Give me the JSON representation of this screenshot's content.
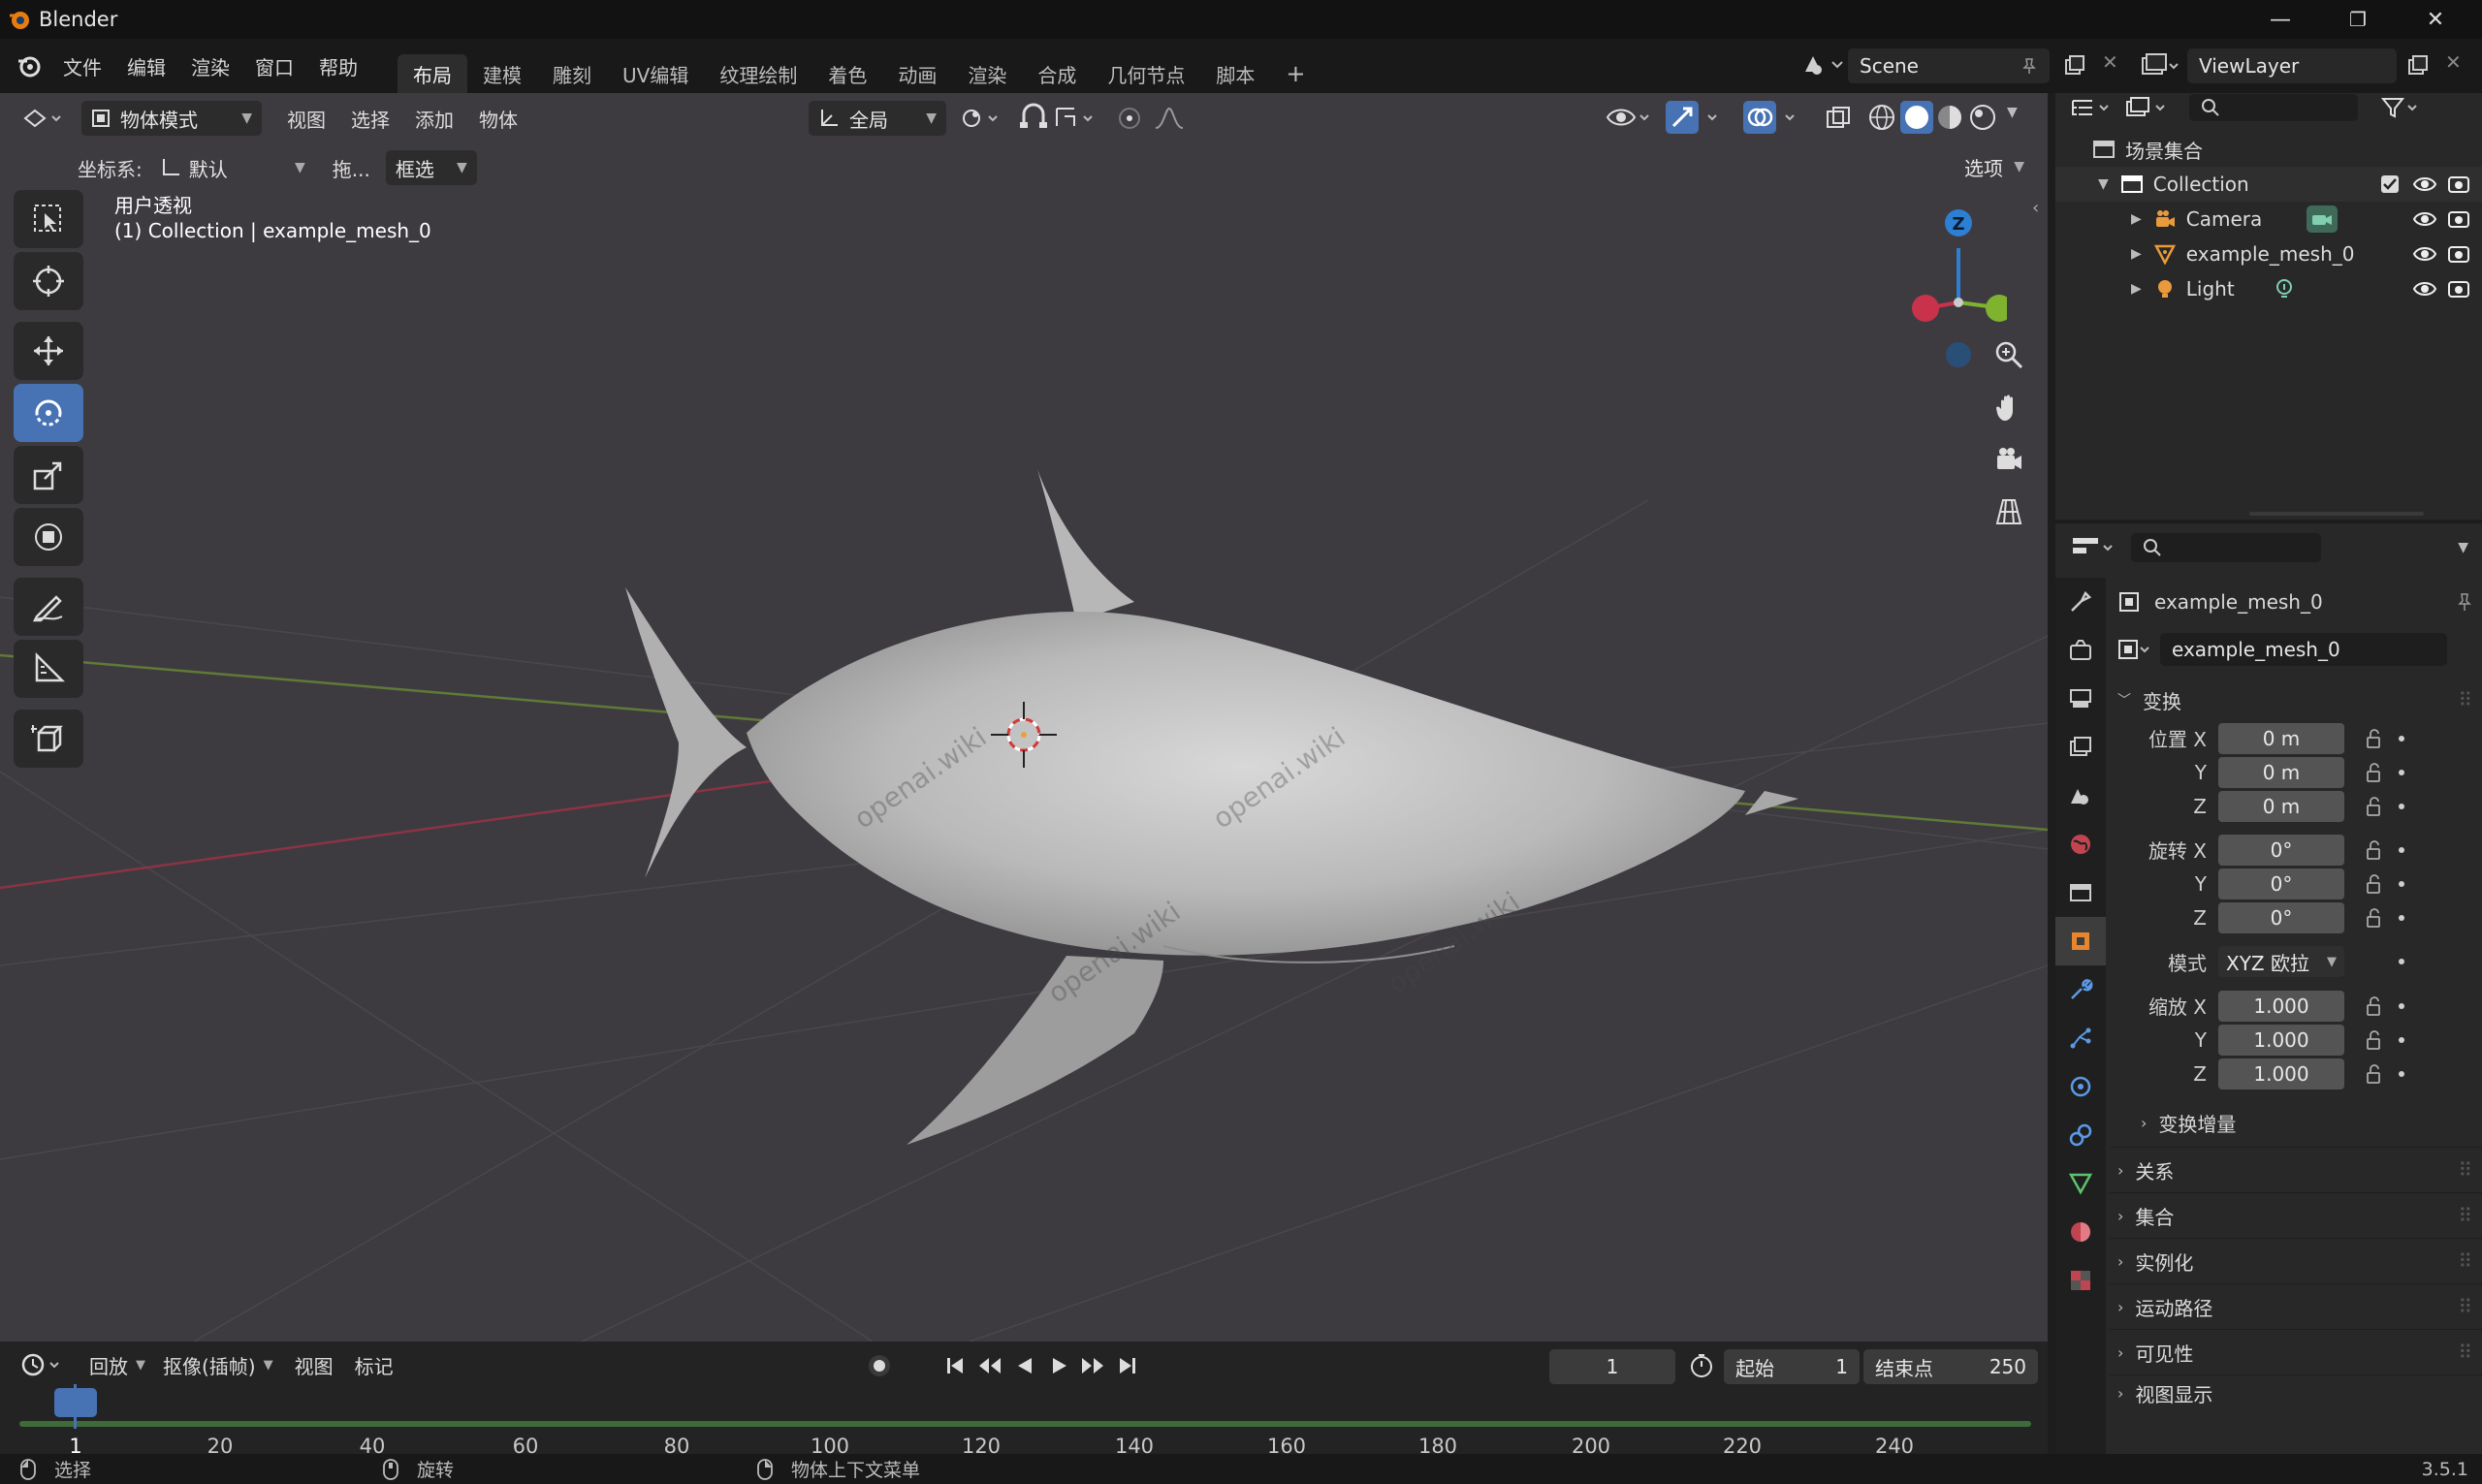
{
  "titlebar": {
    "title": "Blender",
    "minimize": "—",
    "maximize": "❐",
    "close": "✕"
  },
  "menu": [
    "文件",
    "编辑",
    "渲染",
    "窗口",
    "帮助"
  ],
  "workspaces": [
    "布局",
    "建模",
    "雕刻",
    "UV编辑",
    "纹理绘制",
    "着色",
    "动画",
    "渲染",
    "合成",
    "几何节点",
    "脚本"
  ],
  "workspace_add": "+",
  "scene": {
    "name": "Scene",
    "view_layer": "ViewLayer"
  },
  "viewport_header": {
    "mode": "物体模式",
    "menus": [
      "视图",
      "选择",
      "添加",
      "物体"
    ],
    "transform_orientation": "全局",
    "coord_label": "坐标系:",
    "coord_value": "默认",
    "drag_label": "拖...",
    "drag_value": "框选",
    "options": "选项"
  },
  "viewport_overlay": {
    "view_name": "用户透视",
    "context": "(1) Collection | example_mesh_0",
    "watermark": "openai.wiki"
  },
  "gizmo": {
    "z": "Z"
  },
  "outliner": {
    "root": "场景集合",
    "collection": "Collection",
    "items": [
      "Camera",
      "example_mesh_0",
      "Light"
    ]
  },
  "properties": {
    "object_name": "example_mesh_0",
    "data_name": "example_mesh_0",
    "transform_title": "变换",
    "location_label": "位置 X",
    "rotation_label": "旋转 X",
    "scale_label": "缩放 X",
    "y": "Y",
    "z": "Z",
    "location": [
      "0 m",
      "0 m",
      "0 m"
    ],
    "rotation": [
      "0°",
      "0°",
      "0°"
    ],
    "mode_label": "模式",
    "mode_value": "XYZ 欧拉",
    "scale": [
      "1.000",
      "1.000",
      "1.000"
    ],
    "delta_transform": "变换增量",
    "sections": [
      "关系",
      "集合",
      "实例化",
      "运动路径",
      "可见性",
      "视图显示"
    ]
  },
  "timeline": {
    "menus": [
      "回放",
      "抠像(插帧)",
      "视图",
      "标记"
    ],
    "current_frame": "1",
    "start_label": "起始",
    "start": "1",
    "end_label": "结束点",
    "end": "250",
    "ticks": [
      "1",
      "20",
      "40",
      "60",
      "80",
      "100",
      "120",
      "140",
      "160",
      "180",
      "200",
      "220",
      "240"
    ]
  },
  "statusbar": {
    "select": "选择",
    "rotate": "旋转",
    "context_menu": "物体上下文菜单",
    "version": "3.5.1"
  },
  "colors": {
    "accent": "#4772b3",
    "viewport": "#3e3b40",
    "panel": "#282828",
    "x_axis": "#c8324b",
    "y_axis": "#7fb22e",
    "z_axis": "#2c7fd3"
  }
}
